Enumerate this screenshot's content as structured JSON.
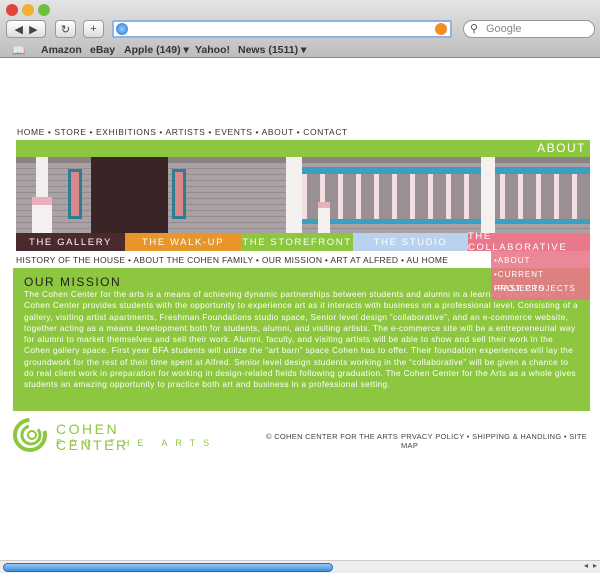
{
  "browser": {
    "search_placeholder": "Google",
    "bookmarks": [
      "Amazon",
      "eBay",
      "Apple (149) ▾",
      "Yahoo!",
      "News (1511) ▾"
    ],
    "back_icon": "back-arrow",
    "forward_icon": "forward-arrow",
    "reload_icon": "reload",
    "add_icon": "plus"
  },
  "topnav": "HOME • STORE • EXHIBITIONS • ARTISTS • EVENTS • ABOUT • CONTACT",
  "section_title": "ABOUT",
  "tabs": [
    {
      "label": "THE GALLERY",
      "color": "#4a2a2c"
    },
    {
      "label": "THE WALK-UP",
      "color": "#e8962a"
    },
    {
      "label": "THE STOREFRONT",
      "color": "#8dc63f"
    },
    {
      "label": "THE STUDIO",
      "color": "#b9d3ee"
    },
    {
      "label": "THE COLLABORATIVE",
      "color": "#e8788a"
    }
  ],
  "subnav": "HISTORY OF THE HOUSE • ABOUT THE COHEN FAMILY • OUR MISSION • ART AT ALFRED • AU HOME",
  "dropdown": [
    "•ABOUT",
    "•CURRENT PROJECTS",
    "•PAST PROJECTS"
  ],
  "mission": {
    "title": "OUR MISSION",
    "body": "The Cohen Center for the arts is a means of achieving dynamic partnerships between students and alumni in a learning environment. The Cohen Center provides students with the opportunity to experience art as it interacts with business on a professional level. Consisting of a gallery, visiting artist apartments, Freshman Foundations studio space, Senior level design “collaborative”, and an e-commerce website, together acting as a means development both for students, alumni, and visiting artists. The e-commerce site will be a entrepreneurial way for alumni to market themselves and sell their work. Alumni, faculty, and visiting artists will be able to show and sell their work in the Cohen gallery space. First year BFA students will utilize the “art barn” space Cohen has to offer. Their foundation experiences will lay the groundwork for the rest of their time spent at Alfred. Senior level design students working in the “collaborative” will be given a chance to do real client work in preparation for working in design-related fields following graduation. The Cohen Center for the Arts as a whole gives students an amazing opportunity to practice both art and business in a professional setting."
  },
  "footer": {
    "logo_line1": "COHEN CENTER",
    "logo_line2": "FOR THE ARTS",
    "copyright": "© COHEN CENTER FOR THE ARTS",
    "links": "PRVACY POLICY • SHIPPING & HANDLING • SITE MAP"
  },
  "brand_green": "#8dc63f"
}
